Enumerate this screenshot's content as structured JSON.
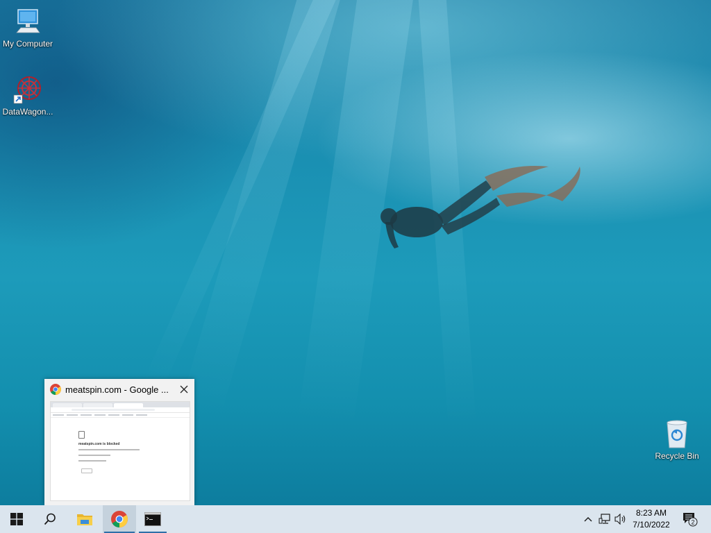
{
  "desktop": {
    "icons": [
      {
        "label": "My Computer",
        "icon": "computer-icon"
      },
      {
        "label": "DataWagon...",
        "icon": "datawagon-shortcut-icon"
      },
      {
        "label": "Recycle Bin",
        "icon": "recycle-bin-icon"
      }
    ]
  },
  "thumbnail": {
    "title": "meatspin.com - Google ...",
    "app_icon": "chrome-icon",
    "close_icon": "close-icon",
    "preview_heading": "meatspin.com is blocked"
  },
  "taskbar": {
    "start_icon": "windows-start-icon",
    "search_icon": "search-icon",
    "pinned": [
      {
        "name": "file-explorer-icon"
      },
      {
        "name": "chrome-icon",
        "active": true
      },
      {
        "name": "command-prompt-icon"
      }
    ],
    "tray": {
      "chevron": "chevron-up-icon",
      "network": "network-icon",
      "volume": "volume-icon",
      "time": "8:23 AM",
      "date": "7/10/2022",
      "notifications_count": "2"
    }
  },
  "colors": {
    "taskbar_bg": "#dbe5ee",
    "accent": "#2e6fa8"
  }
}
